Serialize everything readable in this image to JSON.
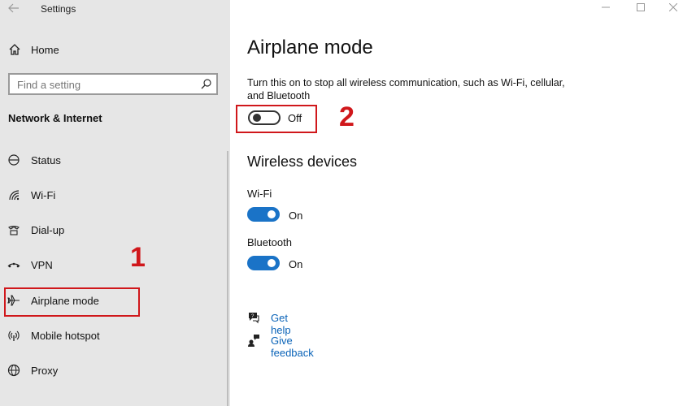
{
  "window": {
    "title": "Settings"
  },
  "sidebar": {
    "home_label": "Home",
    "search_placeholder": "Find a setting",
    "section_title": "Network & Internet",
    "items": [
      {
        "label": "Status",
        "icon": "status-icon"
      },
      {
        "label": "Wi-Fi",
        "icon": "wifi-icon"
      },
      {
        "label": "Dial-up",
        "icon": "dialup-icon"
      },
      {
        "label": "VPN",
        "icon": "vpn-icon"
      },
      {
        "label": "Airplane mode",
        "icon": "airplane-icon"
      },
      {
        "label": "Mobile hotspot",
        "icon": "hotspot-icon"
      },
      {
        "label": "Proxy",
        "icon": "globe-icon"
      }
    ]
  },
  "main": {
    "title": "Airplane mode",
    "description": "Turn this on to stop all wireless communication, such as Wi-Fi, cellular, and Bluetooth",
    "airplane_toggle": {
      "state": "Off"
    },
    "wireless_heading": "Wireless devices",
    "devices": [
      {
        "name": "Wi-Fi",
        "state": "On"
      },
      {
        "name": "Bluetooth",
        "state": "On"
      }
    ],
    "links": [
      {
        "label": "Get help",
        "icon": "help-icon"
      },
      {
        "label": "Give feedback",
        "icon": "feedback-icon"
      }
    ]
  },
  "annotations": {
    "marker_1": "1",
    "marker_2": "2",
    "marker_color": "#d0171b"
  },
  "colors": {
    "sidebar_bg": "#e6e6e6",
    "accent": "#1a73c7",
    "link": "#0a63b8"
  }
}
